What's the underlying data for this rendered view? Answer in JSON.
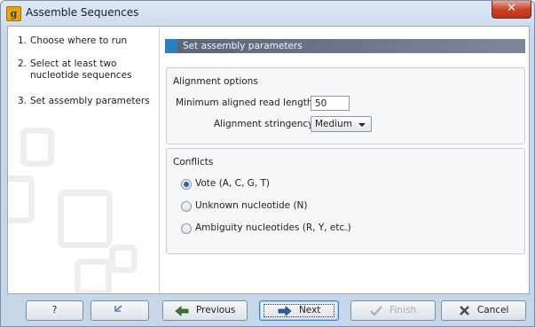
{
  "window": {
    "title": "Assemble Sequences",
    "app_icon_letter": "g",
    "close_glyph": "✕"
  },
  "steps": [
    {
      "num": "1.",
      "label": "Choose where to run"
    },
    {
      "num": "2.",
      "label": "Select at least two nucleotide sequences"
    },
    {
      "num": "3.",
      "label": "Set assembly parameters"
    }
  ],
  "main": {
    "header": "Set assembly parameters",
    "alignment": {
      "title": "Alignment options",
      "min_length_label": "Minimum aligned read length",
      "min_length_value": "50",
      "stringency_label": "Alignment stringency",
      "stringency_value": "Medium"
    },
    "conflicts": {
      "title": "Conflicts",
      "options": [
        {
          "label": "Vote (A, C, G, T)",
          "selected": true
        },
        {
          "label": "Unknown nucleotide (N)",
          "selected": false
        },
        {
          "label": "Ambiguity nucleotides (R, Y, etc.)",
          "selected": false
        }
      ]
    }
  },
  "footer": {
    "help_label": "?",
    "previous_label": "Previous",
    "next_label": "Next",
    "finish_label": "Finish",
    "cancel_label": "Cancel"
  },
  "colors": {
    "header_accent": "#2a7fbe",
    "close_red": "#c8452b",
    "radio_dot": "#2a64b5"
  }
}
